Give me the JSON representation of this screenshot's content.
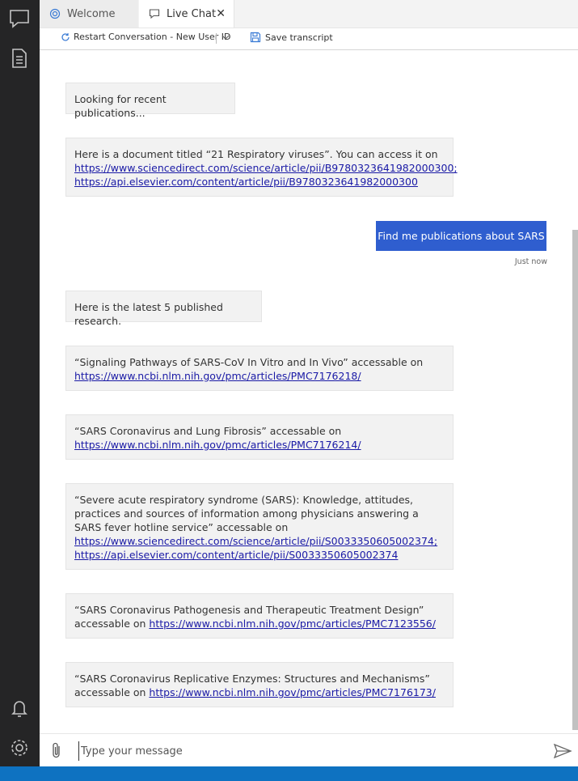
{
  "tabs": [
    {
      "label": "Welcome",
      "icon": "globe-icon"
    },
    {
      "label": "Live Chat",
      "icon": "chat-bubble-icon",
      "close": "✕"
    }
  ],
  "toolbar": {
    "restart_label": "Restart Conversation - New User ID",
    "save_label": "Save transcript"
  },
  "messages": {
    "m1": "Looking for recent publications...",
    "m2_text": "Here is a document titled “21 Respiratory viruses”. You can access it on",
    "m2_link1": "https://www.sciencedirect.com/science/article/pii/B9780323641982000300;",
    "m2_link2": "https://api.elsevier.com/content/article/pii/B9780323641982000300",
    "user": "Find me publications about SARS",
    "user_time": "Just now",
    "m3": "Here is the latest 5 published research.",
    "m4_text": "“Signaling Pathways of SARS-CoV In Vitro and In Vivo” accessable on",
    "m4_link": "https://www.ncbi.nlm.nih.gov/pmc/articles/PMC7176218/",
    "m5_text": "“SARS Coronavirus and Lung Fibrosis” accessable on",
    "m5_link": "https://www.ncbi.nlm.nih.gov/pmc/articles/PMC7176214/",
    "m6_text": "“Severe acute respiratory syndrome (SARS): Knowledge, attitudes, practices and sources of information among physicians answering a SARS fever hotline service” accessable on",
    "m6_link1": "https://www.sciencedirect.com/science/article/pii/S0033350605002374;",
    "m6_link2": "https://api.elsevier.com/content/article/pii/S0033350605002374",
    "m7_text": "“SARS Coronavirus Pathogenesis and Therapeutic Treatment Design” accessable on",
    "m7_link": "https://www.ncbi.nlm.nih.gov/pmc/articles/PMC7123556/",
    "m8_text": "“SARS Coronavirus Replicative Enzymes: Structures and Mechanisms” accessable on",
    "m8_link": "https://www.ncbi.nlm.nih.gov/pmc/articles/PMC7176173/"
  },
  "input": {
    "placeholder": "Type your message"
  },
  "colors": {
    "activity_bar": "#252526",
    "status_bar": "#0e72c1",
    "user_bubble": "#2f5ecf",
    "bot_bubble": "#f2f2f2",
    "link": "#1a1aa6"
  }
}
